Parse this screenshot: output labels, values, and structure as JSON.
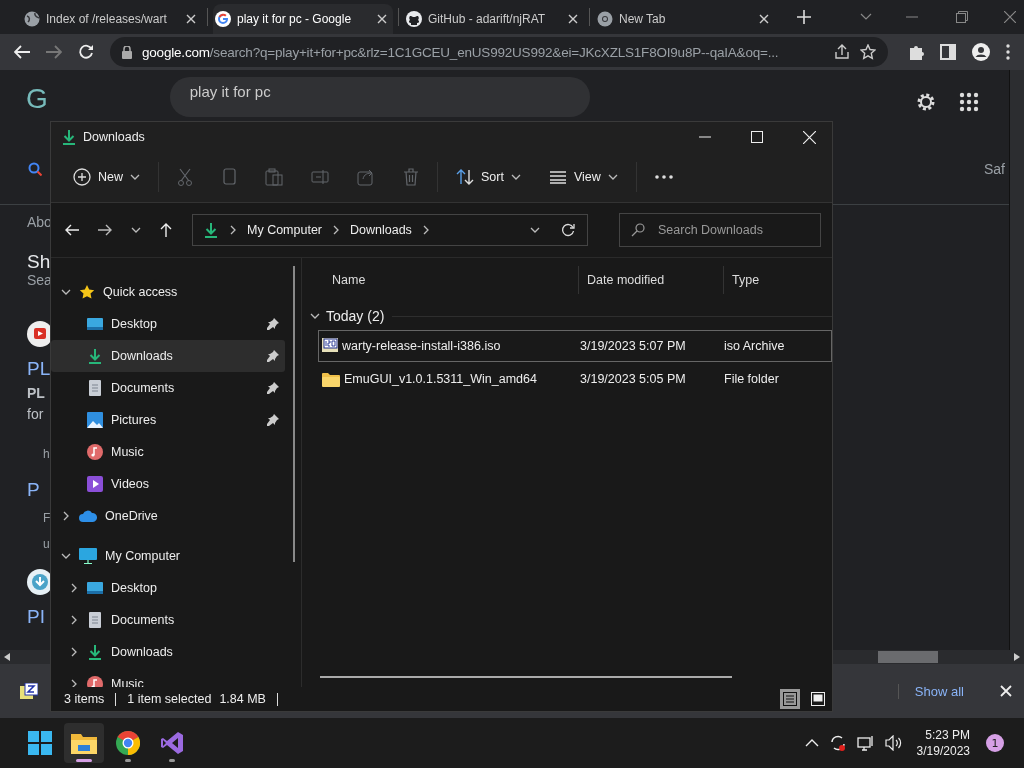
{
  "browser": {
    "tabs": [
      {
        "title": "Index of /releases/wart",
        "kind": "globe",
        "selected": false
      },
      {
        "title": "play it for pc - Google",
        "kind": "google",
        "selected": true
      },
      {
        "title": "GitHub - adarift/njRAT",
        "kind": "github",
        "selected": false
      },
      {
        "title": "New Tab",
        "kind": "chrome",
        "selected": false
      }
    ],
    "address": {
      "domain": "google.com",
      "path": "/search?q=play+it+for+pc&rlz=1C1GCEU_enUS992US992&ei=JKcXZLS1F8OI9u8P--qaIA&oq=..."
    }
  },
  "page": {
    "logo": "G",
    "query": "play it for pc",
    "right_tab": "Saf",
    "fragments": [
      {
        "kind": "meta",
        "text": "Abo"
      },
      {
        "kind": "heading",
        "text": "Sh"
      },
      {
        "kind": "meta",
        "text": "Sea"
      },
      {
        "kind": "favicon-red"
      },
      {
        "kind": "link",
        "text": "PL"
      },
      {
        "kind": "bold",
        "text": "PL"
      },
      {
        "kind": "snippet",
        "text": "for"
      },
      {
        "kind": "small",
        "text": "h"
      },
      {
        "kind": "link",
        "text": "P"
      },
      {
        "kind": "small",
        "text": "F"
      },
      {
        "kind": "small",
        "text": "u"
      },
      {
        "kind": "favicon-blue"
      },
      {
        "kind": "link",
        "text": "PI"
      }
    ]
  },
  "downloads_bar": {
    "link": "Show all"
  },
  "explorer": {
    "title": "Downloads",
    "toolbar": [
      {
        "kind": "new",
        "label": "New",
        "disabled": false
      },
      {
        "kind": "cut",
        "disabled": true
      },
      {
        "kind": "copy",
        "disabled": true
      },
      {
        "kind": "paste",
        "disabled": true
      },
      {
        "kind": "rename",
        "disabled": true
      },
      {
        "kind": "share",
        "disabled": true
      },
      {
        "kind": "delete",
        "disabled": true
      },
      {
        "kind": "sort",
        "label": "Sort",
        "disabled": false
      },
      {
        "kind": "view",
        "label": "View",
        "disabled": false
      },
      {
        "kind": "more",
        "disabled": false
      }
    ],
    "breadcrumb": [
      "My Computer",
      "Downloads"
    ],
    "search": {
      "placeholder": "Search Downloads"
    },
    "nav": [
      {
        "label": "Quick access",
        "kind": "star",
        "expanded": true,
        "children": [
          {
            "label": "Desktop",
            "kind": "desktop",
            "pinned": true,
            "selected": false
          },
          {
            "label": "Downloads",
            "kind": "downloads",
            "pinned": true,
            "selected": true
          },
          {
            "label": "Documents",
            "kind": "documents",
            "pinned": true,
            "selected": false
          },
          {
            "label": "Pictures",
            "kind": "pictures",
            "pinned": true,
            "selected": false
          },
          {
            "label": "Music",
            "kind": "music",
            "pinned": false,
            "selected": false
          },
          {
            "label": "Videos",
            "kind": "videos",
            "pinned": false,
            "selected": false
          }
        ]
      },
      {
        "label": "OneDrive",
        "kind": "cloud",
        "expanded": false
      },
      {
        "label": "My Computer",
        "kind": "computer",
        "expanded": true,
        "children": [
          {
            "label": "Desktop",
            "kind": "desktop",
            "expanded": false,
            "selected": false
          },
          {
            "label": "Documents",
            "kind": "documents",
            "expanded": false,
            "selected": false
          },
          {
            "label": "Downloads",
            "kind": "downloads",
            "expanded": false,
            "selected": false
          },
          {
            "label": "Music",
            "kind": "music",
            "expanded": false,
            "selected": false
          }
        ]
      }
    ],
    "columns": [
      "Name",
      "Date modified",
      "Type"
    ],
    "groups": [
      {
        "label": "Today (2)",
        "expanded": true,
        "rows": [
          {
            "name": "warty-release-install-i386.iso",
            "date": "3/19/2023 5:07 PM",
            "type": "iso Archive",
            "kind": "iso",
            "selected": true
          },
          {
            "name": "EmuGUI_v1.0.1.5311_Win_amd64",
            "date": "3/19/2023 5:05 PM",
            "type": "File folder",
            "kind": "folder",
            "selected": false
          }
        ]
      }
    ],
    "status": {
      "count": "3 items",
      "selection": "1 item selected",
      "size": "1.84 MB"
    },
    "views": [
      {
        "kind": "details",
        "selected": true
      },
      {
        "kind": "large",
        "selected": false
      }
    ]
  },
  "taskbar": {
    "apps": [
      {
        "kind": "start"
      },
      {
        "kind": "explorer",
        "active": true
      },
      {
        "kind": "chrome",
        "active": false
      },
      {
        "kind": "vs",
        "active": false
      }
    ],
    "time": "5:23 PM",
    "date": "3/19/2023",
    "badge": "1"
  }
}
